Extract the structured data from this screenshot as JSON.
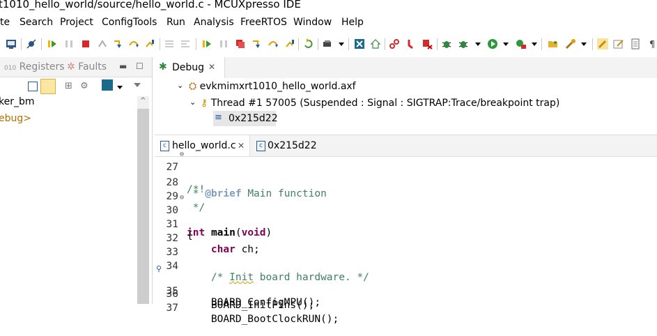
{
  "window": {
    "title": "t1010_hello_world/source/hello_world.c - MCUXpresso IDE"
  },
  "menu": [
    "te",
    "Search",
    "Project",
    "ConfigTools",
    "Run",
    "Analysis",
    "FreeRTOS",
    "Window",
    "Help"
  ],
  "left_panel": {
    "tabs": [
      "Registers",
      "Faults"
    ],
    "tree": [
      "ker_bm",
      "ebug>"
    ]
  },
  "debug": {
    "tab": "Debug",
    "axf": "evkmimxrt1010_hello_world.axf",
    "thread": "Thread #1 57005 (Suspended : Signal : SIGTRAP:Trace/breakpoint trap)",
    "frame": "0x215d22"
  },
  "editor": {
    "tabs": [
      "hello_world.c",
      "0x215d22"
    ],
    "lines": [
      {
        "n": "27",
        "text": "/*!"
      },
      {
        "n": "28",
        "text": " * @brief Main function"
      },
      {
        "n": "29",
        "text": " */"
      },
      {
        "n": "30",
        "text": "int main(void)"
      },
      {
        "n": "31",
        "text": "{"
      },
      {
        "n": "32",
        "text": "    char ch;"
      },
      {
        "n": "33",
        "text": ""
      },
      {
        "n": "34",
        "text": "    /* Init board hardware. */"
      },
      {
        "n": "35",
        "text": "    BOARD_ConfigMPU();"
      },
      {
        "n": "36",
        "text": "    BOARD_InitPins();"
      },
      {
        "n": "37",
        "text": "    BOARD_BootClockRUN();"
      }
    ],
    "segments": {
      "l28_tag": "@brief",
      "l28_rest": " Main function",
      "l28_pre": " * ",
      "l30_kw": "int",
      "l30_fn": "main",
      "l30_paren1": "(",
      "l30_void": "void",
      "l30_paren2": ")",
      "l32_kw": "char",
      "l32_rest": " ch;",
      "l34_pre": "/* ",
      "l34_sq": "Init",
      "l34_post": " board hardware. */"
    }
  },
  "colors": {
    "keyword": "#7f0055",
    "comment": "#3f7f5f",
    "doc_tag": "#7f9fbf",
    "accent": "#1f6fbf"
  }
}
